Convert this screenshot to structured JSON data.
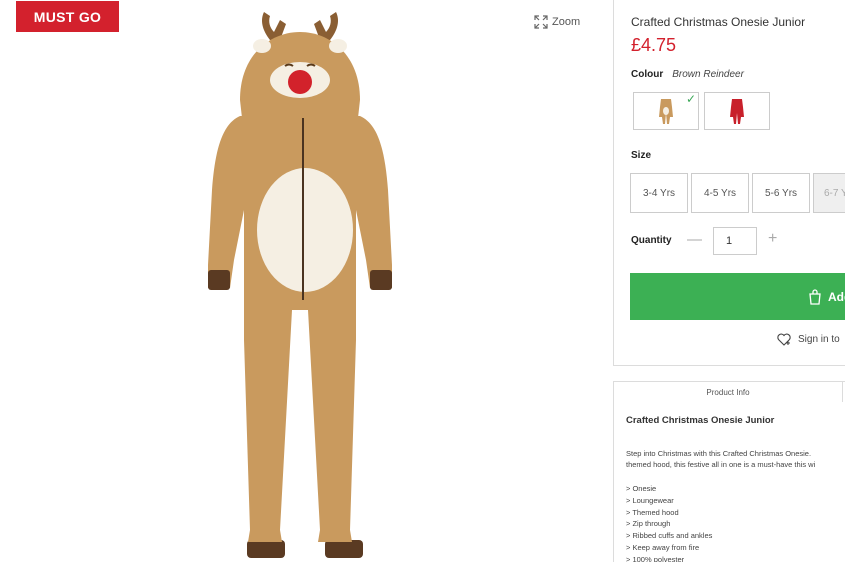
{
  "badge": "MUST GO",
  "zoom_label": "Zoom",
  "product": {
    "title": "Crafted Christmas Onesie Junior",
    "price": "£4.75",
    "colour_label": "Colour",
    "colour_value": "Brown Reindeer",
    "size_label": "Size",
    "sizes": [
      "3-4 Yrs",
      "4-5 Yrs",
      "5-6 Yrs",
      "6-7 Yrs"
    ],
    "quantity_label": "Quantity",
    "quantity": "1",
    "add_label": "Add",
    "signin_label": "Sign in to"
  },
  "info": {
    "tab": "Product Info",
    "title": "Crafted Christmas Onesie Junior",
    "desc1": "Step into Christmas with this Crafted Christmas Onesie.",
    "desc2": "themed hood, this festive all in one is a must-have this wi",
    "features": [
      "> Onesie",
      "> Loungewear",
      "> Themed hood",
      "> Zip through",
      "> Ribbed cuffs and ankles",
      "> Keep away from fire",
      "> 100% polyester"
    ]
  },
  "colors": {
    "accent_red": "#d3212d",
    "add_green": "#3cb054",
    "check_green": "#3aa757"
  }
}
